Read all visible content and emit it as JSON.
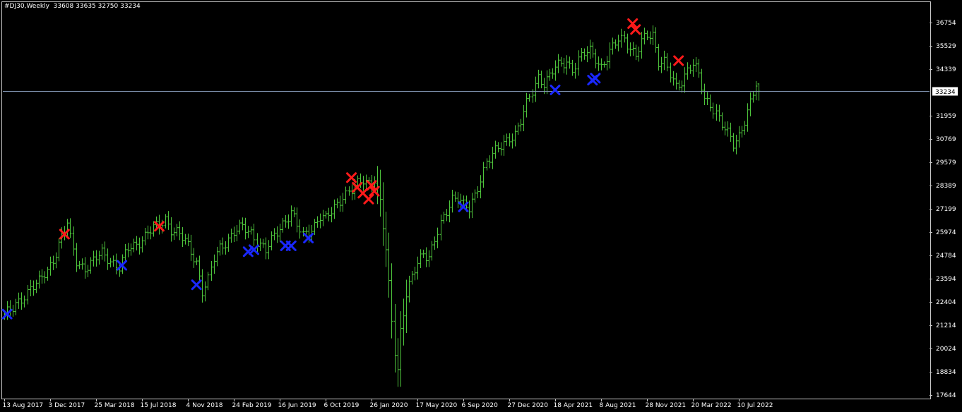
{
  "title": "#DJ30,Weekly  33608 33635 32750 33234",
  "current_price_label": "33234",
  "colors": {
    "background": "#000000",
    "bars": "#4ec53c",
    "axis_text": "#ffffff",
    "frame": "#c8c8c8",
    "price_line": "#8296b4",
    "sell_marker": "#ff1a1a",
    "buy_marker": "#1a28ff"
  },
  "chart_data": {
    "type": "ohlc",
    "title": "#DJ30,Weekly",
    "ohlc_last": {
      "open": 33608,
      "high": 33635,
      "low": 32750,
      "close": 33234
    },
    "y_ticks": [
      "36754",
      "35529",
      "34339",
      "33234",
      "31959",
      "30769",
      "29579",
      "28389",
      "27199",
      "25974",
      "24784",
      "23594",
      "22404",
      "21214",
      "20024",
      "18834",
      "17644"
    ],
    "y_range": [
      17644,
      37500
    ],
    "x_ticks": [
      "13 Aug 2017",
      "3 Dec 2017",
      "25 Mar 2018",
      "15 Jul 2018",
      "4 Nov 2018",
      "24 Feb 2019",
      "16 Jun 2019",
      "6 Oct 2019",
      "26 Jan 2020",
      "17 May 2020",
      "6 Sep 2020",
      "27 Dec 2020",
      "18 Apr 2021",
      "8 Aug 2021",
      "28 Nov 2021",
      "20 Mar 2022",
      "10 Jul 2022"
    ],
    "x_tick_weeks": [
      0,
      16,
      32,
      48,
      64,
      80,
      96,
      112,
      128,
      144,
      160,
      176,
      192,
      208,
      224,
      240,
      256
    ],
    "grid": false,
    "price_line": 33234,
    "anchors": [
      [
        0,
        21800
      ],
      [
        3,
        22000
      ],
      [
        6,
        22600
      ],
      [
        9,
        23200
      ],
      [
        12,
        23400
      ],
      [
        15,
        24000
      ],
      [
        18,
        25000
      ],
      [
        20,
        25800
      ],
      [
        22,
        26400
      ],
      [
        23,
        25600
      ],
      [
        25,
        24500
      ],
      [
        28,
        24200
      ],
      [
        31,
        24500
      ],
      [
        34,
        24900
      ],
      [
        37,
        24600
      ],
      [
        40,
        24200
      ],
      [
        43,
        25100
      ],
      [
        46,
        25400
      ],
      [
        50,
        26000
      ],
      [
        54,
        26300
      ],
      [
        56,
        26700
      ],
      [
        58,
        26200
      ],
      [
        60,
        26000
      ],
      [
        63,
        25500
      ],
      [
        65,
        25000
      ],
      [
        67,
        24500
      ],
      [
        69,
        23000
      ],
      [
        71,
        23500
      ],
      [
        73,
        24600
      ],
      [
        75,
        25200
      ],
      [
        78,
        25700
      ],
      [
        80,
        26000
      ],
      [
        83,
        26200
      ],
      [
        86,
        26000
      ],
      [
        89,
        25400
      ],
      [
        91,
        25000
      ],
      [
        94,
        25800
      ],
      [
        97,
        26500
      ],
      [
        100,
        27000
      ],
      [
        102,
        26300
      ],
      [
        104,
        25800
      ],
      [
        106,
        26100
      ],
      [
        108,
        26400
      ],
      [
        110,
        26800
      ],
      [
        112,
        26600
      ],
      [
        115,
        27300
      ],
      [
        118,
        27900
      ],
      [
        121,
        28100
      ],
      [
        123,
        28400
      ],
      [
        125,
        28700
      ],
      [
        127,
        28600
      ],
      [
        129,
        28700
      ],
      [
        131,
        27500
      ],
      [
        133,
        25000
      ],
      [
        135,
        21500
      ],
      [
        136,
        20000
      ],
      [
        137,
        19000
      ],
      [
        138,
        21000
      ],
      [
        140,
        22800
      ],
      [
        142,
        23600
      ],
      [
        144,
        24400
      ],
      [
        146,
        25000
      ],
      [
        148,
        24800
      ],
      [
        150,
        25600
      ],
      [
        152,
        26300
      ],
      [
        154,
        27000
      ],
      [
        156,
        27800
      ],
      [
        158,
        27900
      ],
      [
        160,
        27400
      ],
      [
        162,
        27100
      ],
      [
        164,
        27800
      ],
      [
        166,
        28800
      ],
      [
        168,
        29700
      ],
      [
        170,
        30000
      ],
      [
        172,
        30200
      ],
      [
        174,
        30500
      ],
      [
        176,
        30900
      ],
      [
        178,
        31100
      ],
      [
        180,
        31700
      ],
      [
        182,
        32500
      ],
      [
        184,
        33200
      ],
      [
        186,
        34000
      ],
      [
        188,
        33700
      ],
      [
        190,
        34000
      ],
      [
        192,
        34400
      ],
      [
        194,
        34600
      ],
      [
        196,
        34800
      ],
      [
        198,
        34400
      ],
      [
        200,
        34800
      ],
      [
        202,
        35100
      ],
      [
        204,
        35300
      ],
      [
        206,
        35000
      ],
      [
        208,
        34500
      ],
      [
        210,
        34900
      ],
      [
        212,
        35400
      ],
      [
        214,
        35900
      ],
      [
        216,
        36000
      ],
      [
        218,
        35500
      ],
      [
        220,
        35000
      ],
      [
        222,
        35700
      ],
      [
        224,
        36100
      ],
      [
        226,
        36200
      ],
      [
        228,
        34800
      ],
      [
        230,
        34700
      ],
      [
        232,
        34000
      ],
      [
        234,
        33400
      ],
      [
        236,
        33800
      ],
      [
        238,
        34400
      ],
      [
        240,
        34600
      ],
      [
        242,
        34000
      ],
      [
        244,
        32800
      ],
      [
        246,
        32600
      ],
      [
        248,
        32200
      ],
      [
        250,
        31500
      ],
      [
        252,
        31000
      ],
      [
        254,
        30500
      ],
      [
        256,
        31000
      ],
      [
        258,
        31800
      ],
      [
        260,
        32600
      ],
      [
        262,
        33500
      ],
      [
        263,
        33234
      ]
    ],
    "markers": [
      {
        "type": "sell",
        "week": 21,
        "price": 25900
      },
      {
        "type": "sell",
        "week": 54,
        "price": 26300
      },
      {
        "type": "sell",
        "week": 121,
        "price": 28800
      },
      {
        "type": "sell",
        "week": 123,
        "price": 28300
      },
      {
        "type": "sell",
        "week": 125,
        "price": 28000
      },
      {
        "type": "sell",
        "week": 127,
        "price": 27700
      },
      {
        "type": "sell",
        "week": 129,
        "price": 28100
      },
      {
        "type": "sell",
        "week": 128,
        "price": 28400
      },
      {
        "type": "sell",
        "week": 219,
        "price": 36700
      },
      {
        "type": "sell",
        "week": 220,
        "price": 36400
      },
      {
        "type": "sell",
        "week": 235,
        "price": 34800
      },
      {
        "type": "buy",
        "week": 1,
        "price": 21800
      },
      {
        "type": "buy",
        "week": 41,
        "price": 24300
      },
      {
        "type": "buy",
        "week": 67,
        "price": 23300
      },
      {
        "type": "buy",
        "week": 85,
        "price": 25000
      },
      {
        "type": "buy",
        "week": 87,
        "price": 25100
      },
      {
        "type": "buy",
        "week": 98,
        "price": 25300
      },
      {
        "type": "buy",
        "week": 100,
        "price": 25300
      },
      {
        "type": "buy",
        "week": 106,
        "price": 25700
      },
      {
        "type": "buy",
        "week": 160,
        "price": 27300
      },
      {
        "type": "buy",
        "week": 192,
        "price": 33300
      },
      {
        "type": "buy",
        "week": 205,
        "price": 33800
      },
      {
        "type": "buy",
        "week": 206,
        "price": 33900
      }
    ]
  }
}
